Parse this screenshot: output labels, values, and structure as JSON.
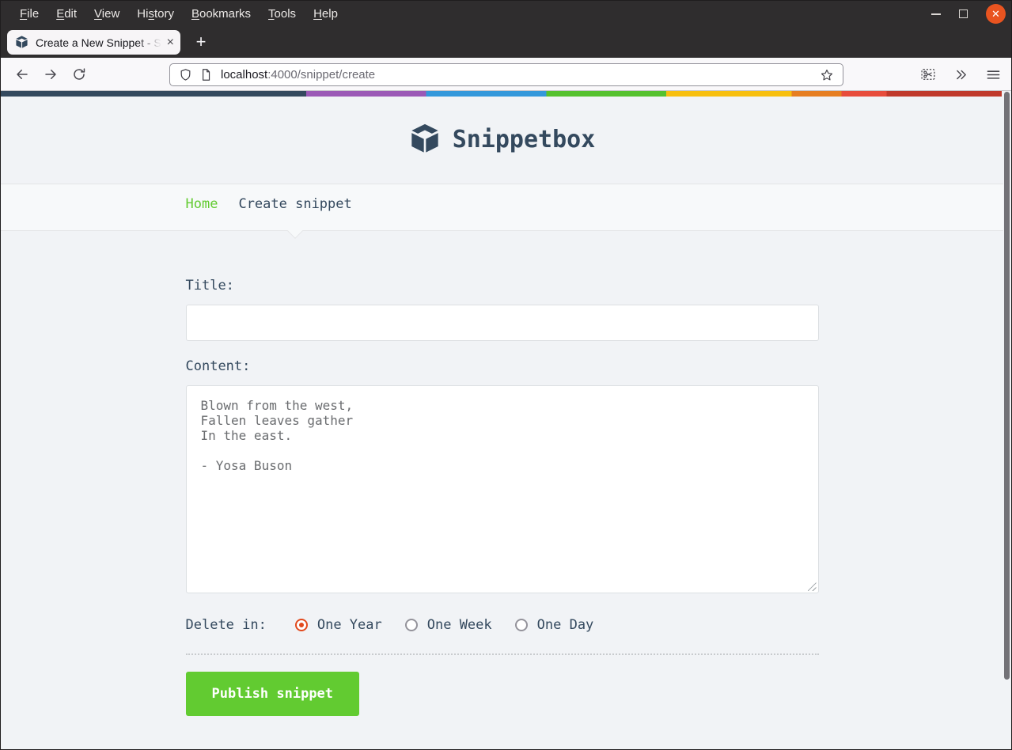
{
  "browser": {
    "menu_items": [
      {
        "label": "File",
        "mnemonic": "F"
      },
      {
        "label": "Edit",
        "mnemonic": "E"
      },
      {
        "label": "View",
        "mnemonic": "V"
      },
      {
        "label": "History",
        "mnemonic": "s"
      },
      {
        "label": "Bookmarks",
        "mnemonic": "B"
      },
      {
        "label": "Tools",
        "mnemonic": "T"
      },
      {
        "label": "Help",
        "mnemonic": "H"
      }
    ],
    "window_controls": {
      "close_glyph": "✕"
    },
    "tab": {
      "title": "Create a New Snippet - Sn",
      "close_glyph": "×"
    },
    "new_tab_glyph": "+",
    "url": {
      "host": "localhost",
      "path": ":4000/snippet/create"
    }
  },
  "page": {
    "brand": "Snippetbox",
    "nav_links": [
      {
        "label": "Home",
        "active": false
      },
      {
        "label": "Create snippet",
        "active": true
      }
    ],
    "form": {
      "title_label": "Title:",
      "title_value": "",
      "content_label": "Content:",
      "content_value": "Blown from the west,\nFallen leaves gather\nIn the east.\n\n- Yosa Buson",
      "expires_label": "Delete in:",
      "expires_options": [
        {
          "label": "One Year",
          "checked": true
        },
        {
          "label": "One Week",
          "checked": false
        },
        {
          "label": "One Day",
          "checked": false
        }
      ],
      "submit_label": "Publish snippet"
    },
    "colors": {
      "brand_navy": "#34495E",
      "accent_green": "#62CB31",
      "radio_checked_orange": "#E2491D",
      "close_button_orange": "#E95420",
      "rainbow": [
        "#34495E",
        "#9B59B6",
        "#3498DB",
        "#55C12E",
        "#F7BF0F",
        "#E67E22",
        "#E74C3C",
        "#C0392B"
      ],
      "rainbow_stops": [
        0,
        30.5,
        42.5,
        54.5,
        66.5,
        79,
        84,
        88.5,
        100
      ]
    }
  }
}
